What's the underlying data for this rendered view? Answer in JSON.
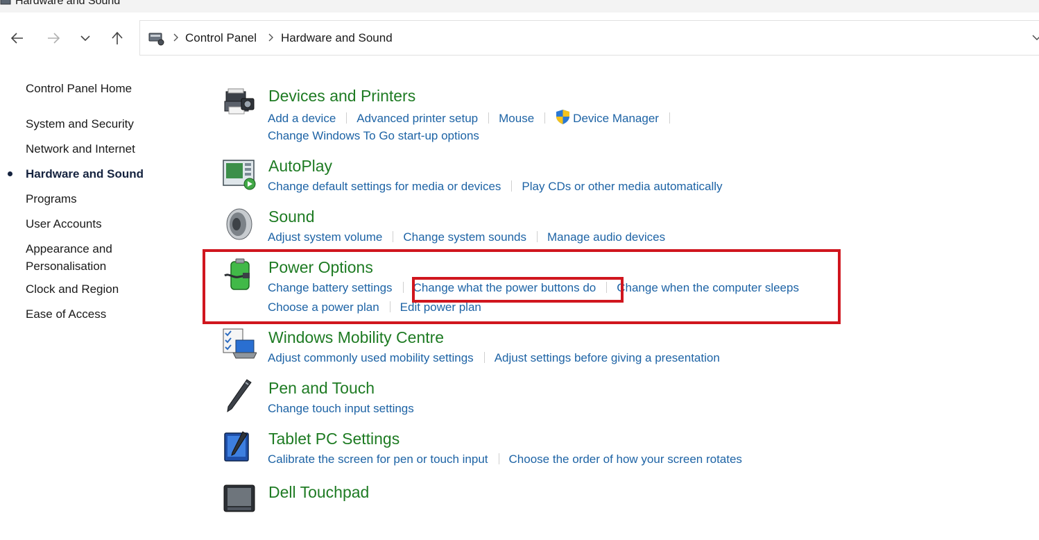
{
  "window": {
    "title": "Hardware and Sound"
  },
  "navigation": {
    "back_icon": "arrow-left-icon",
    "forward_icon": "arrow-right-icon",
    "recent_icon": "chevron-down-icon",
    "up_icon": "arrow-up-icon"
  },
  "address_bar": {
    "icon": "control-panel-icon",
    "crumbs": [
      "Control Panel",
      "Hardware and Sound"
    ]
  },
  "sidebar": {
    "home": "Control Panel Home",
    "items": [
      "System and Security",
      "Network and Internet",
      "Hardware and Sound",
      "Programs",
      "User Accounts",
      "Appearance and",
      "Personalisation",
      "Clock and Region",
      "Ease of Access"
    ],
    "active_index": 2
  },
  "categories": {
    "devices": {
      "title": "Devices and Printers",
      "icon": "printer-icon",
      "links": [
        "Add a device",
        "Advanced printer setup",
        "Mouse",
        "Device Manager",
        "Change Windows To Go start-up options"
      ]
    },
    "autoplay": {
      "title": "AutoPlay",
      "icon": "autoplay-icon",
      "links": [
        "Change default settings for media or devices",
        "Play CDs or other media automatically"
      ]
    },
    "sound": {
      "title": "Sound",
      "icon": "speaker-icon",
      "links": [
        "Adjust system volume",
        "Change system sounds",
        "Manage audio devices"
      ]
    },
    "power": {
      "title": "Power Options",
      "icon": "battery-icon",
      "links": [
        "Change battery settings",
        "Change what the power buttons do",
        "Change when the computer sleeps",
        "Choose a power plan",
        "Edit power plan"
      ]
    },
    "mobility": {
      "title": "Windows Mobility Centre",
      "icon": "mobility-centre-icon",
      "links": [
        "Adjust commonly used mobility settings",
        "Adjust settings before giving a presentation"
      ]
    },
    "pen": {
      "title": "Pen and Touch",
      "icon": "pen-icon",
      "links": [
        "Change touch input settings"
      ]
    },
    "tablet": {
      "title": "Tablet PC Settings",
      "icon": "tablet-icon",
      "links": [
        "Calibrate the screen for pen or touch input",
        "Choose the order of how your screen rotates"
      ]
    },
    "touchpad": {
      "title": "Dell Touchpad",
      "icon": "touchpad-icon"
    }
  },
  "colors": {
    "heading_green": "#1e7b23",
    "link_blue": "#1d63a5",
    "highlight_red": "#d0161e"
  }
}
